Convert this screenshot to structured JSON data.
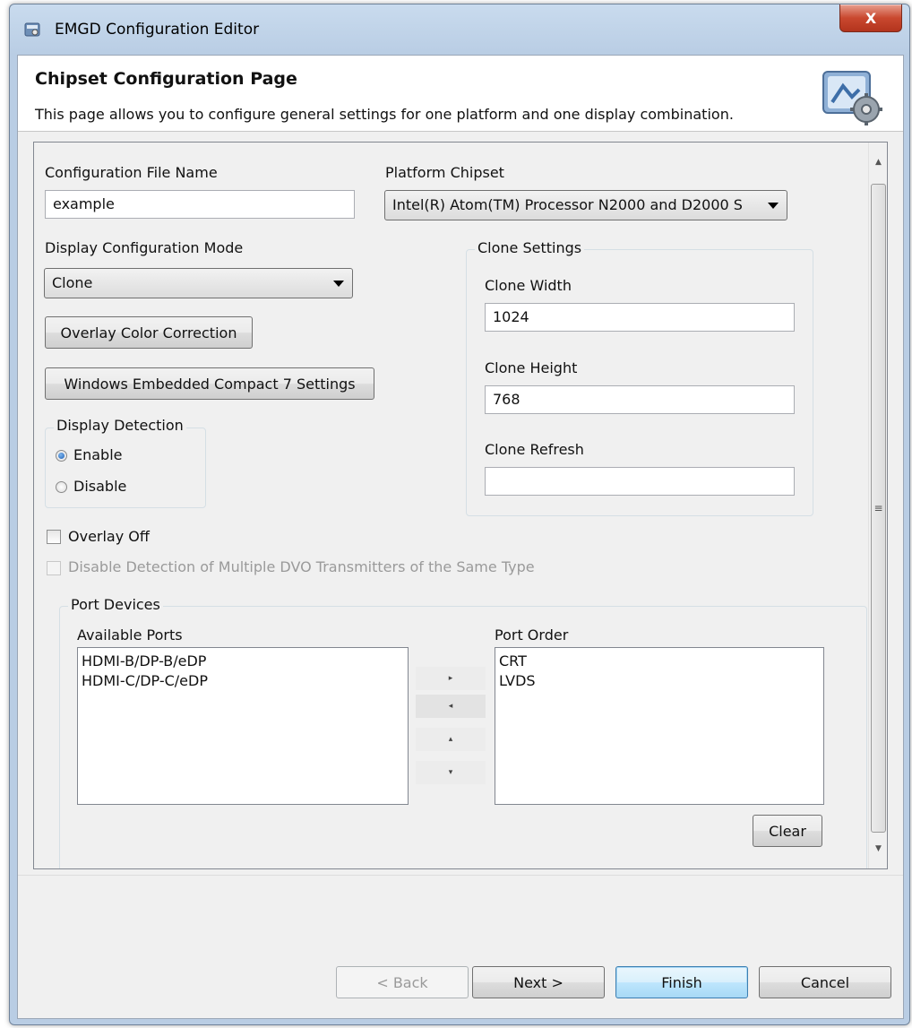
{
  "window": {
    "title": "EMGD Configuration Editor",
    "close_label": "X"
  },
  "header": {
    "title": "Chipset Configuration Page",
    "description": "This page allows you to configure general settings for one platform and one display combination.",
    "icon": "config-gear-icon"
  },
  "form": {
    "config_file_label": "Configuration File Name",
    "config_file_value": "example",
    "platform_label": "Platform Chipset",
    "platform_value": "Intel(R) Atom(TM) Processor N2000 and D2000 S",
    "display_mode_label": "Display Configuration Mode",
    "display_mode_value": "Clone",
    "overlay_color_button": "Overlay Color Correction",
    "wec7_button": "Windows Embedded Compact 7 Settings",
    "display_detection": {
      "title": "Display Detection",
      "enable_label": "Enable",
      "disable_label": "Disable",
      "selected": "Enable"
    },
    "overlay_off_label": "Overlay Off",
    "overlay_off_checked": false,
    "disable_dvo_label": "Disable Detection of Multiple DVO Transmitters of the Same Type",
    "disable_dvo_checked": false
  },
  "clone": {
    "title": "Clone Settings",
    "width_label": "Clone Width",
    "width_value": "1024",
    "height_label": "Clone Height",
    "height_value": "768",
    "refresh_label": "Clone Refresh",
    "refresh_value": ""
  },
  "ports": {
    "title": "Port Devices",
    "available_label": "Available Ports",
    "available": [
      "HDMI-B/DP-B/eDP",
      "HDMI-C/DP-C/eDP"
    ],
    "order_label": "Port Order",
    "order": [
      "CRT",
      "LVDS"
    ],
    "move_right": "▸",
    "move_left": "◂",
    "move_up": "▴",
    "move_down": "▾",
    "clear_button": "Clear"
  },
  "scrollbar": {
    "up": "▲",
    "down": "▼",
    "grip": "≡"
  },
  "footer": {
    "back": "< Back",
    "next": "Next >",
    "finish": "Finish",
    "cancel": "Cancel"
  },
  "colors": {
    "title_bar": "#c4d6ec",
    "close_button": "#c9482f",
    "dialog_bg": "#f0f0f0"
  }
}
